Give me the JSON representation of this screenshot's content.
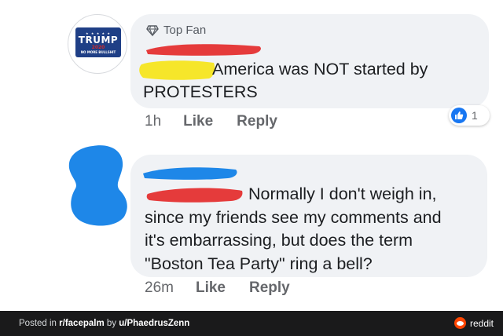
{
  "comment1": {
    "badge": {
      "stars": "★ ★ ★ ★ ★",
      "name": "TRUMP",
      "year": "2020",
      "slogan": "NO MORE BULLSHIT"
    },
    "top_fan_label": "Top Fan",
    "text_line1": "America was NOT started by",
    "text_line2": "PROTESTERS",
    "time": "1h",
    "like_label": "Like",
    "reply_label": "Reply",
    "reaction_count": "1"
  },
  "comment2": {
    "lines": [
      "Normally I don't weigh in,",
      "since my friends see my comments and",
      "it's embarrassing,  but does the term",
      "\"Boston Tea Party\" ring a bell?"
    ],
    "time": "26m",
    "like_label": "Like",
    "reply_label": "Reply"
  },
  "footer": {
    "prefix": "Posted in ",
    "subreddit": "r/facepalm",
    "by": " by ",
    "user": "u/PhaedrusZenn",
    "brand": "reddit"
  },
  "colors": {
    "bubble": "#f0f2f5",
    "redaction_red": "#e53b3b",
    "redaction_yellow": "#f6e62a",
    "redaction_blue": "#1e87e8",
    "like_blue": "#1877f2",
    "footer_bg": "#1a1a1b",
    "reddit_orange": "#ff4500"
  }
}
